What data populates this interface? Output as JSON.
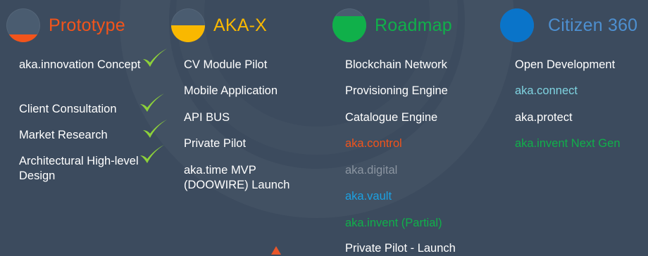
{
  "phases": [
    {
      "title": "Prototype",
      "color": "#f2541b",
      "fill_level": 0.22,
      "items": [
        "aka.innovation Concept",
        "Client Consultation",
        "Market Research",
        "Architectural High-level Design"
      ]
    },
    {
      "title": "AKA-X",
      "color": "#f9b800",
      "fill_level": 0.5,
      "items": [
        "CV Module Pilot",
        "Mobile Application",
        "API BUS",
        "Private Pilot",
        "aka.time MVP (DOOWIRE) Launch"
      ]
    },
    {
      "title": "Roadmap",
      "color": "#10b04a",
      "fill_level": 0.78,
      "items": [
        {
          "text": "Blockchain Network",
          "color": "#ffffff"
        },
        {
          "text": "Provisioning Engine",
          "color": "#ffffff"
        },
        {
          "text": "Catalogue Engine",
          "color": "#ffffff"
        },
        {
          "text": "aka.control",
          "color": "#f2541b"
        },
        {
          "text": "aka.digital",
          "color": "#8b95a1"
        },
        {
          "text": "aka.vault",
          "color": "#1ba1e2"
        },
        {
          "text": "aka.invent (Partial)",
          "color": "#10b04a"
        },
        {
          "text": "Private Pilot - Launch",
          "color": "#ffffff"
        }
      ]
    },
    {
      "title": "Citizen 360",
      "color": "#0a74c9",
      "title_color": "#4d8fd0",
      "fill_level": 1.0,
      "items": [
        {
          "text": "Open Development",
          "color": "#ffffff"
        },
        {
          "text": "aka.connect",
          "color": "#7fd3e0"
        },
        {
          "text": "aka.protect",
          "color": "#ffffff"
        },
        {
          "text": "aka.invent Next Gen",
          "color": "#10b04a"
        }
      ]
    }
  ],
  "check_color": "#8dd13a",
  "check_icon": "checkmark-icon",
  "arrow_icon": "arrow-up-icon"
}
